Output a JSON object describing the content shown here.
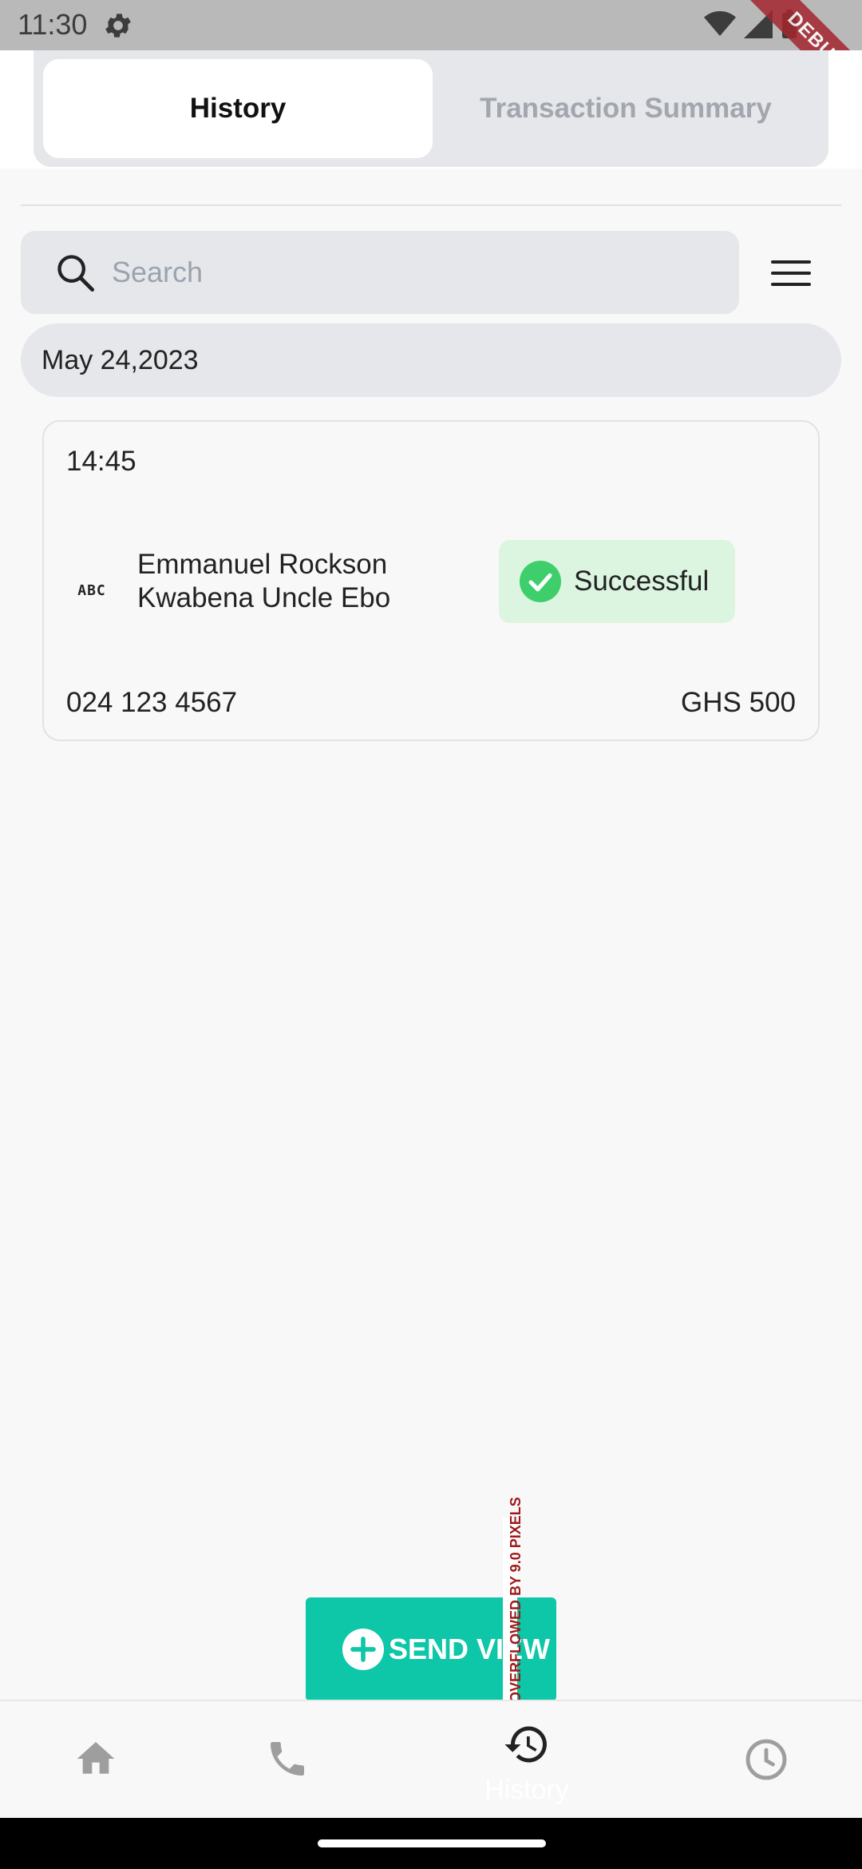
{
  "status_bar": {
    "time": "11:30",
    "debug_label": "DEBUG"
  },
  "tabs": {
    "active_label": "History",
    "inactive_label": "Transaction Summary"
  },
  "search": {
    "placeholder": "Search",
    "value": ""
  },
  "date_header": "May 24,2023",
  "transaction": {
    "time": "14:45",
    "name": "Emmanuel Rockson Kwabena Uncle Ebo",
    "status": "Successful",
    "phone": "024 123 4567",
    "amount": "GHS 500",
    "icon": "abc-icon"
  },
  "overflow_warning": "OVERFLOWED BY 9.0 PIXELS",
  "send_button": {
    "label": "SEND VIEW"
  },
  "bottom_nav": {
    "items": [
      {
        "icon": "home-icon",
        "label": ""
      },
      {
        "icon": "phone-icon",
        "label": ""
      },
      {
        "icon": "history-icon",
        "label": "History"
      },
      {
        "icon": "clock-icon",
        "label": ""
      }
    ]
  },
  "colors": {
    "accent": "#0ec7a8",
    "success_bg": "#dbf5e0",
    "success_icon": "#3ecf6c",
    "segment_bg": "#e5e7eb"
  }
}
